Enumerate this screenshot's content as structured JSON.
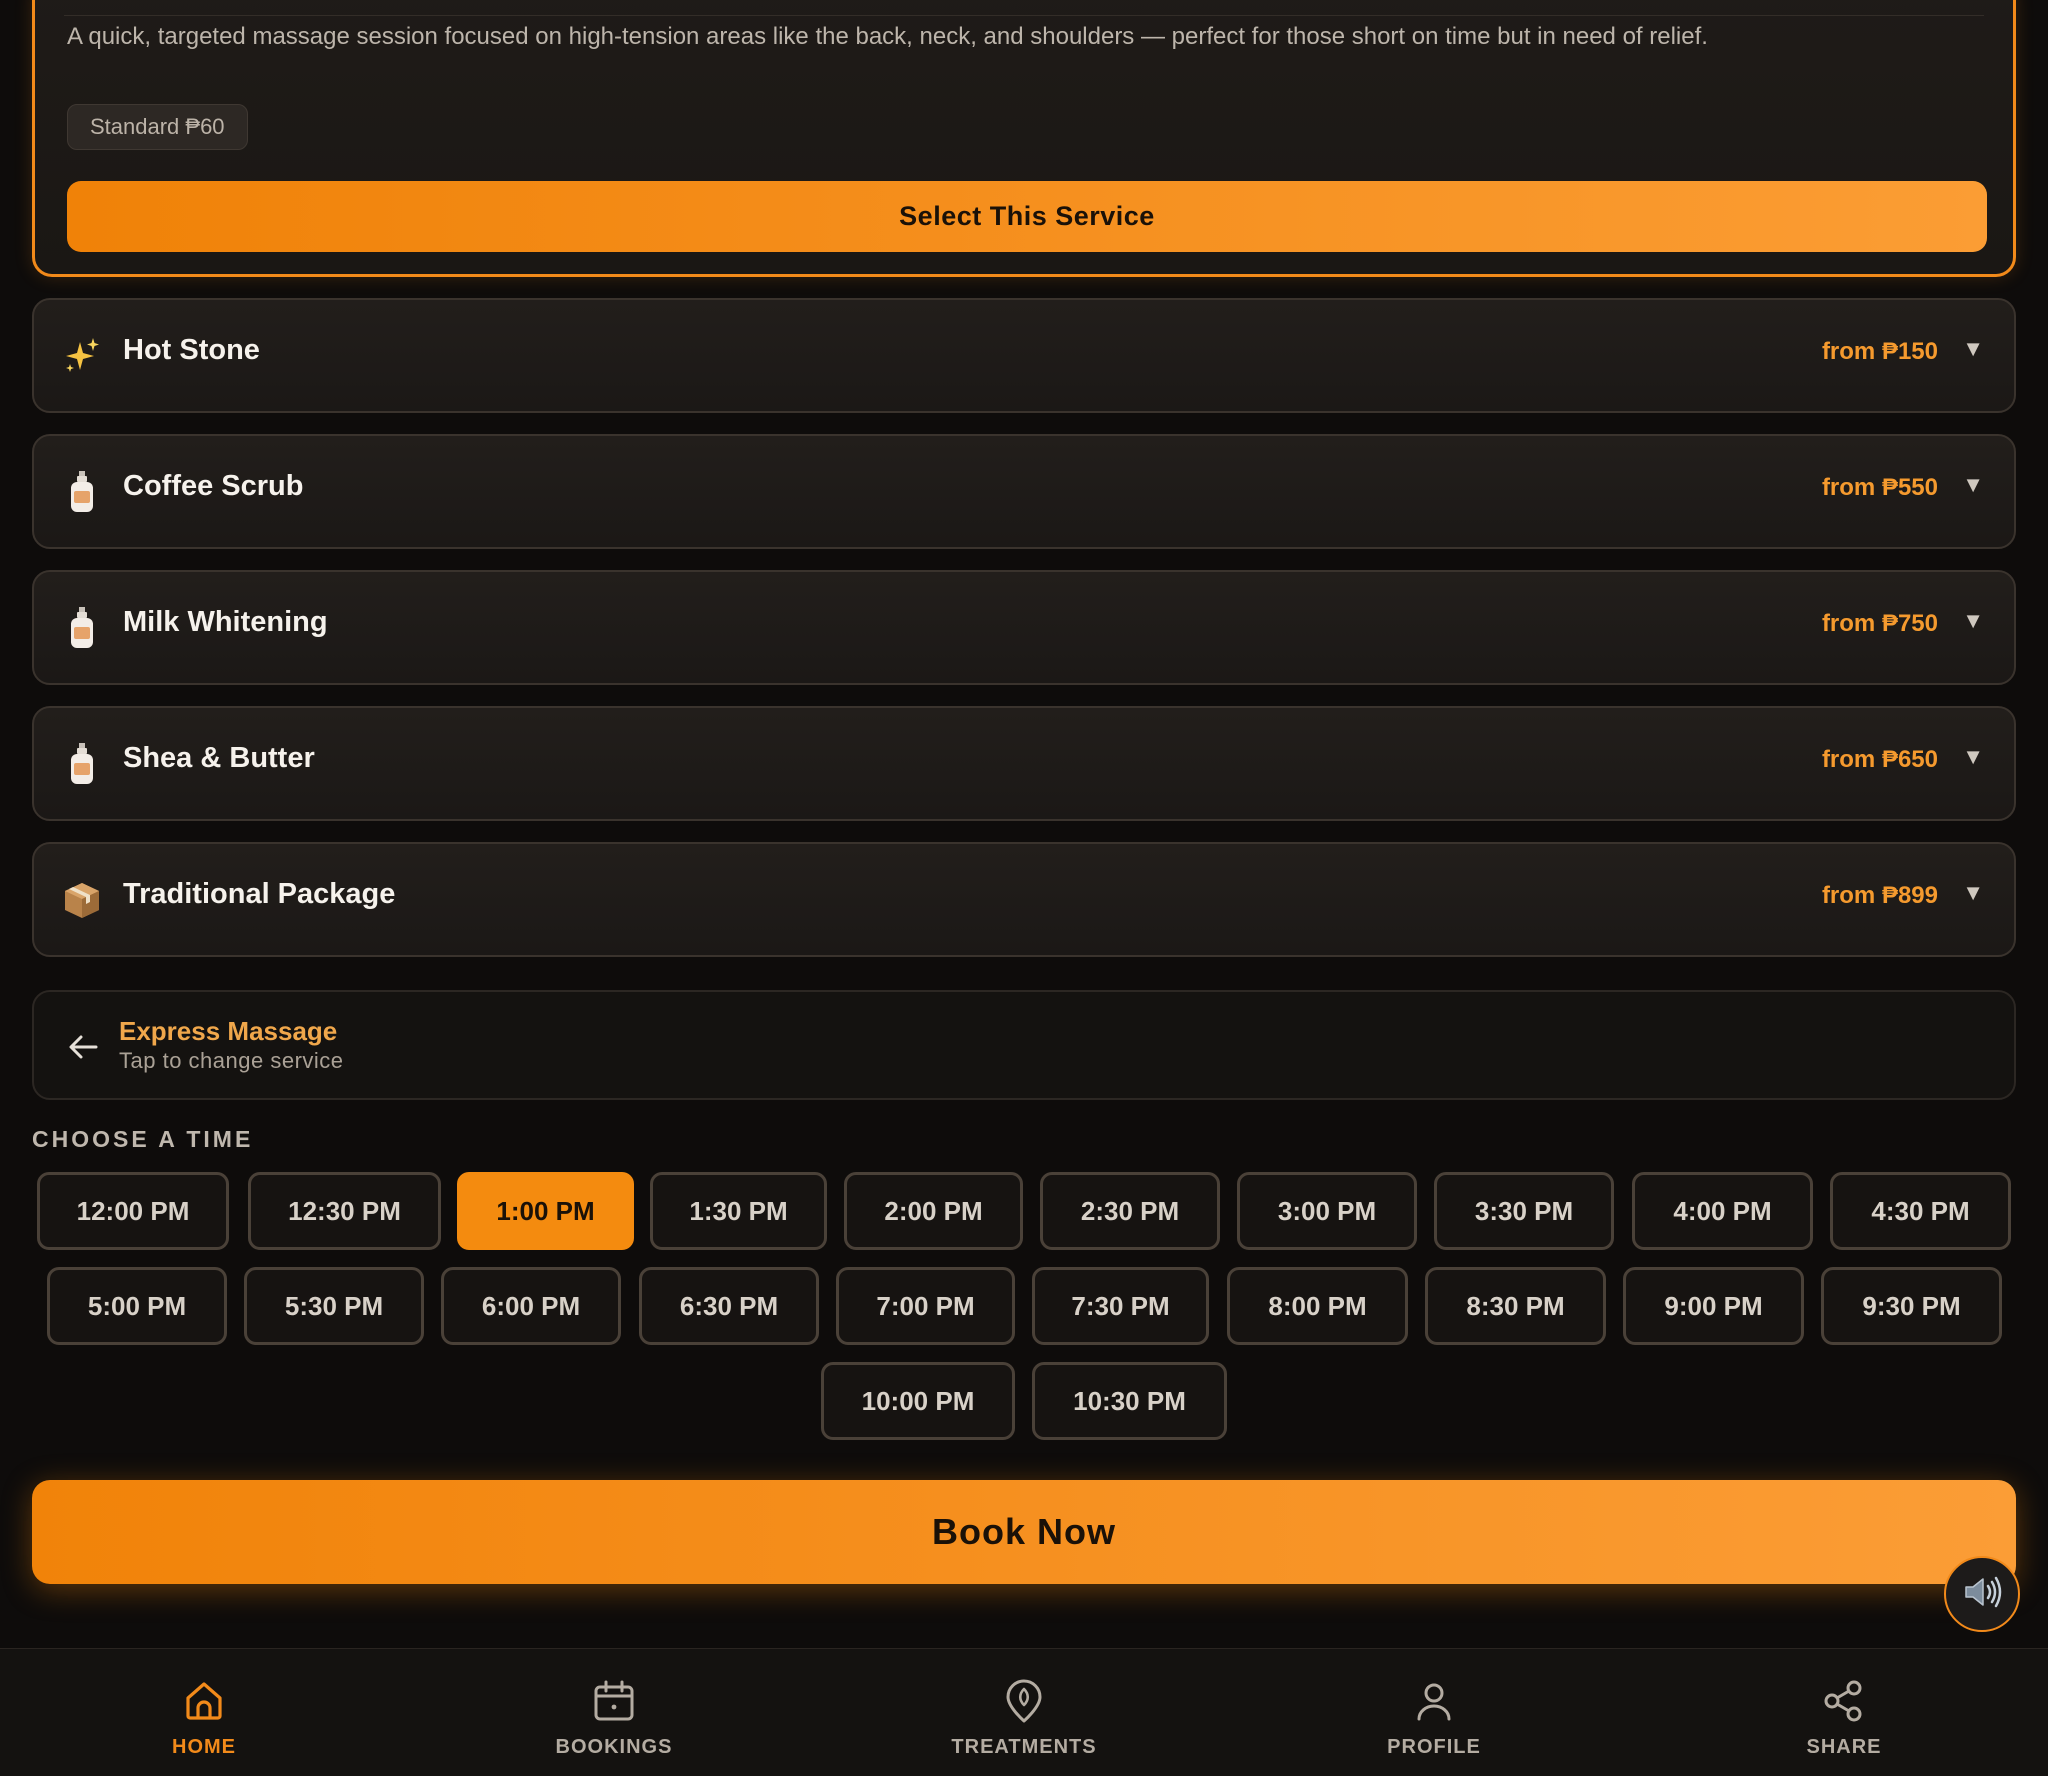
{
  "expanded_service": {
    "description": "A quick, targeted massage session focused on high-tension areas like the back, neck, and shoulders — perfect for those short on time but in need of relief.",
    "price_tier": "Standard ₱60",
    "select_label": "Select This Service"
  },
  "services": [
    {
      "icon": "sparkles-icon",
      "name": "Hot Stone",
      "price": "from ₱150"
    },
    {
      "icon": "lotion-bottle-icon",
      "name": "Coffee Scrub",
      "price": "from ₱550"
    },
    {
      "icon": "lotion-bottle-icon",
      "name": "Milk Whitening",
      "price": "from ₱750"
    },
    {
      "icon": "lotion-bottle-icon",
      "name": "Shea & Butter",
      "price": "from ₱650"
    },
    {
      "icon": "package-icon",
      "name": "Traditional Package",
      "price": "from ₱899"
    }
  ],
  "selected_service": {
    "name": "Express Massage",
    "hint": "Tap to change service"
  },
  "time_section_label": "CHOOSE A TIME",
  "time_slots": [
    "12:00 PM",
    "12:30 PM",
    "1:00 PM",
    "1:30 PM",
    "2:00 PM",
    "2:30 PM",
    "3:00 PM",
    "3:30 PM",
    "4:00 PM",
    "4:30 PM",
    "5:00 PM",
    "5:30 PM",
    "6:00 PM",
    "6:30 PM",
    "7:00 PM",
    "7:30 PM",
    "8:00 PM",
    "8:30 PM",
    "9:00 PM",
    "9:30 PM",
    "10:00 PM",
    "10:30 PM"
  ],
  "selected_time": "1:00 PM",
  "book_label": "Book Now",
  "nav": [
    {
      "icon": "home-icon",
      "label": "HOME",
      "active": true
    },
    {
      "icon": "calendar-icon",
      "label": "BOOKINGS",
      "active": false
    },
    {
      "icon": "location-pin-icon",
      "label": "TREATMENTS",
      "active": false
    },
    {
      "icon": "user-icon",
      "label": "PROFILE",
      "active": false
    },
    {
      "icon": "share-icon",
      "label": "SHARE",
      "active": false
    }
  ],
  "colors": {
    "accent": "#f28a1a",
    "background": "#0e0c0b",
    "card": "#1f1b18",
    "price_text": "#f59a2e"
  }
}
